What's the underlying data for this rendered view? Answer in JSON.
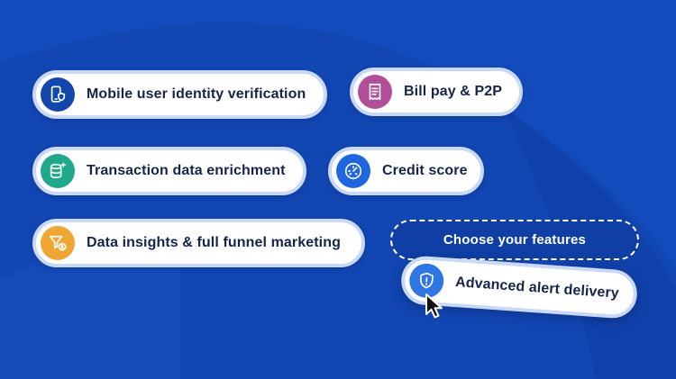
{
  "features": [
    {
      "id": "mobile",
      "label": "Mobile user identity verification",
      "icon": "phone-shield-icon",
      "color": "#1447ad"
    },
    {
      "id": "billpay",
      "label": "Bill pay & P2P",
      "icon": "receipt-icon",
      "color": "#b04f98"
    },
    {
      "id": "transaction",
      "label": "Transaction data enrichment",
      "icon": "database-sparkle-icon",
      "color": "#1fa889"
    },
    {
      "id": "credit",
      "label": "Credit score",
      "icon": "speedometer-icon",
      "color": "#1f66e0"
    },
    {
      "id": "insights",
      "label": "Data insights & full funnel marketing",
      "icon": "funnel-dollar-icon",
      "color": "#f0a632"
    },
    {
      "id": "alert",
      "label": "Advanced alert delivery",
      "icon": "shield-alert-icon",
      "color": "#2f76e3"
    }
  ],
  "drop_zone": {
    "label": "Choose your features"
  },
  "colors": {
    "background": "#1246b3",
    "pill_border": "#c9d8f4",
    "text": "#16244a"
  },
  "cursor_icon": "pointer-cursor-icon"
}
